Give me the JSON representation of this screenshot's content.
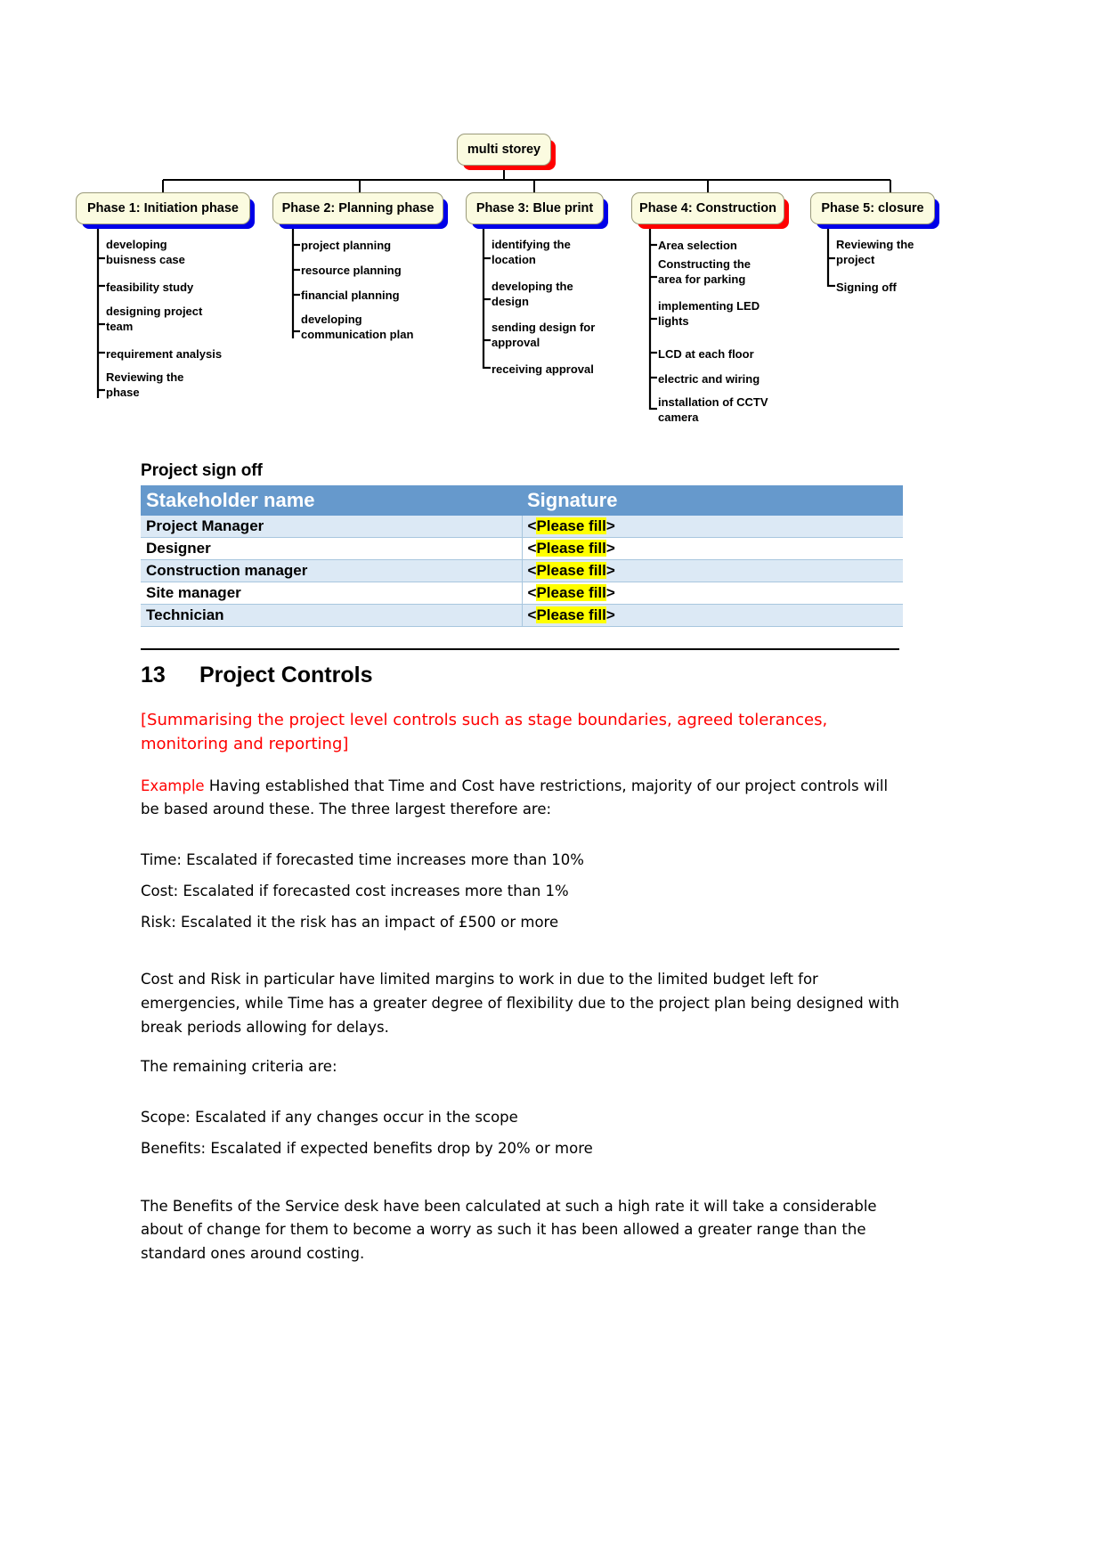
{
  "diagram": {
    "root": {
      "label": "multi storey",
      "shadow_color": "#ff0000"
    },
    "phases": [
      {
        "label": "Phase 1: Initiation phase",
        "shadow_color": "#0000e8",
        "items": [
          "developing\nbuisness case",
          "feasibility study",
          "designing project\nteam",
          "requirement analysis",
          "Reviewing the\nphase"
        ]
      },
      {
        "label": "Phase 2: Planning phase",
        "shadow_color": "#0000e8",
        "items": [
          "project planning",
          "resource planning",
          "financial planning",
          "developing\ncommunication plan"
        ]
      },
      {
        "label": "Phase 3: Blue print",
        "shadow_color": "#0000e8",
        "items": [
          "identifying the\nlocation",
          "developing the\ndesign",
          "sending design for\napproval",
          "receiving approval"
        ]
      },
      {
        "label": "Phase 4: Construction",
        "shadow_color": "#ff0000",
        "items": [
          "Area selection",
          "Constructing the\narea for parking",
          "implementing LED\nlights",
          "LCD at each floor",
          "electric and wiring",
          "installation of CCTV\ncamera"
        ]
      },
      {
        "label": "Phase 5: closure",
        "shadow_color": "#0000e8",
        "items": [
          "Reviewing the\nproject",
          "Signing off"
        ]
      }
    ]
  },
  "signoff": {
    "title": "Project sign off",
    "columns": [
      "Stakeholder name",
      "Signature"
    ],
    "fill_prefix": "<",
    "fill_text": "Please fill",
    "fill_suffix": ">",
    "rows": [
      {
        "name": "Project Manager",
        "signature": "<Please fill>"
      },
      {
        "name": "Designer",
        "signature": "<Please fill>"
      },
      {
        "name": "Construction manager",
        "signature": "<Please fill>"
      },
      {
        "name": "Site manager",
        "signature": "<Please fill>"
      },
      {
        "name": "Technician",
        "signature": "<Please fill>"
      }
    ],
    "header_color": "#6699cc",
    "stripe_color": "#dce9f5",
    "highlight_color": "#ffff00"
  },
  "section13": {
    "number": "13",
    "title": "Project Controls",
    "guidance": "[Summarising the project level controls such as stage boundaries, agreed tolerances, monitoring and reporting]",
    "example_label": "Example",
    "example_body": " Having established that Time and Cost have restrictions, majority of our project controls will be based around these.  The three largest therefore are:",
    "criteria_primary": [
      "Time: Escalated if forecasted time increases more than 10%",
      "Cost: Escalated if forecasted cost increases more than 1%",
      "Risk: Escalated it the risk has an impact of £500 or more"
    ],
    "paragraph_margins": "Cost and Risk in particular have limited margins to work in due to the limited budget left for emergencies, while Time has a greater degree of flexibility due to the project plan being designed with break periods allowing for delays.",
    "remaining_intro": "The remaining criteria are:",
    "criteria_remaining": [
      "Scope: Escalated if any changes occur in the scope",
      "Benefits: Escalated if expected benefits drop by 20% or more"
    ],
    "paragraph_benefits": "The Benefits of the Service desk have been calculated at such a high rate it will take a considerable about of change for them to become a worry as such it has been allowed a greater range than the standard ones around costing."
  }
}
